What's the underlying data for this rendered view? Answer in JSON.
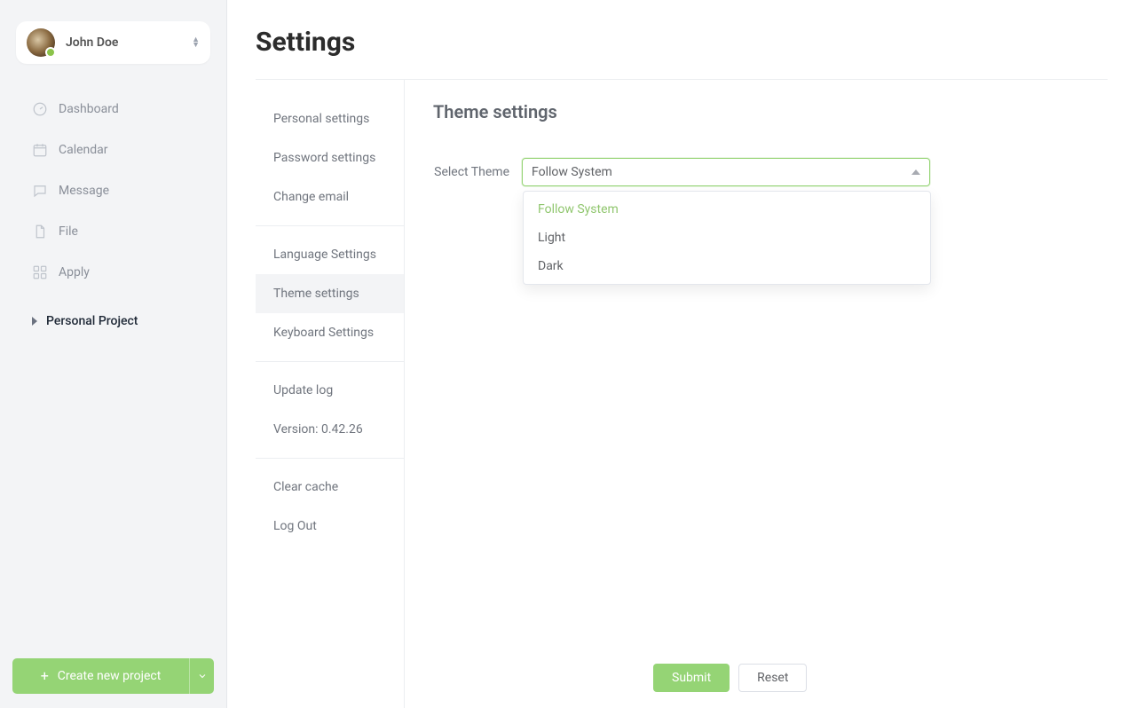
{
  "profile": {
    "name": "John Doe"
  },
  "sidebar": {
    "items": [
      {
        "label": "Dashboard"
      },
      {
        "label": "Calendar"
      },
      {
        "label": "Message"
      },
      {
        "label": "File"
      },
      {
        "label": "Apply"
      }
    ],
    "section": {
      "label": "Personal Project"
    },
    "create_label": "Create new project"
  },
  "page": {
    "title": "Settings"
  },
  "settings_nav": {
    "group1": [
      {
        "label": "Personal settings"
      },
      {
        "label": "Password settings"
      },
      {
        "label": "Change email"
      }
    ],
    "group2": [
      {
        "label": "Language Settings"
      },
      {
        "label": "Theme settings",
        "active": true
      },
      {
        "label": "Keyboard Settings"
      }
    ],
    "group3": [
      {
        "label": "Update log"
      },
      {
        "label": "Version: 0.42.26"
      }
    ],
    "group4": [
      {
        "label": "Clear cache"
      },
      {
        "label": "Log Out"
      }
    ]
  },
  "theme": {
    "section_title": "Theme settings",
    "label": "Select Theme",
    "value": "Follow System",
    "options": [
      "Follow System",
      "Light",
      "Dark"
    ]
  },
  "actions": {
    "submit": "Submit",
    "reset": "Reset"
  }
}
